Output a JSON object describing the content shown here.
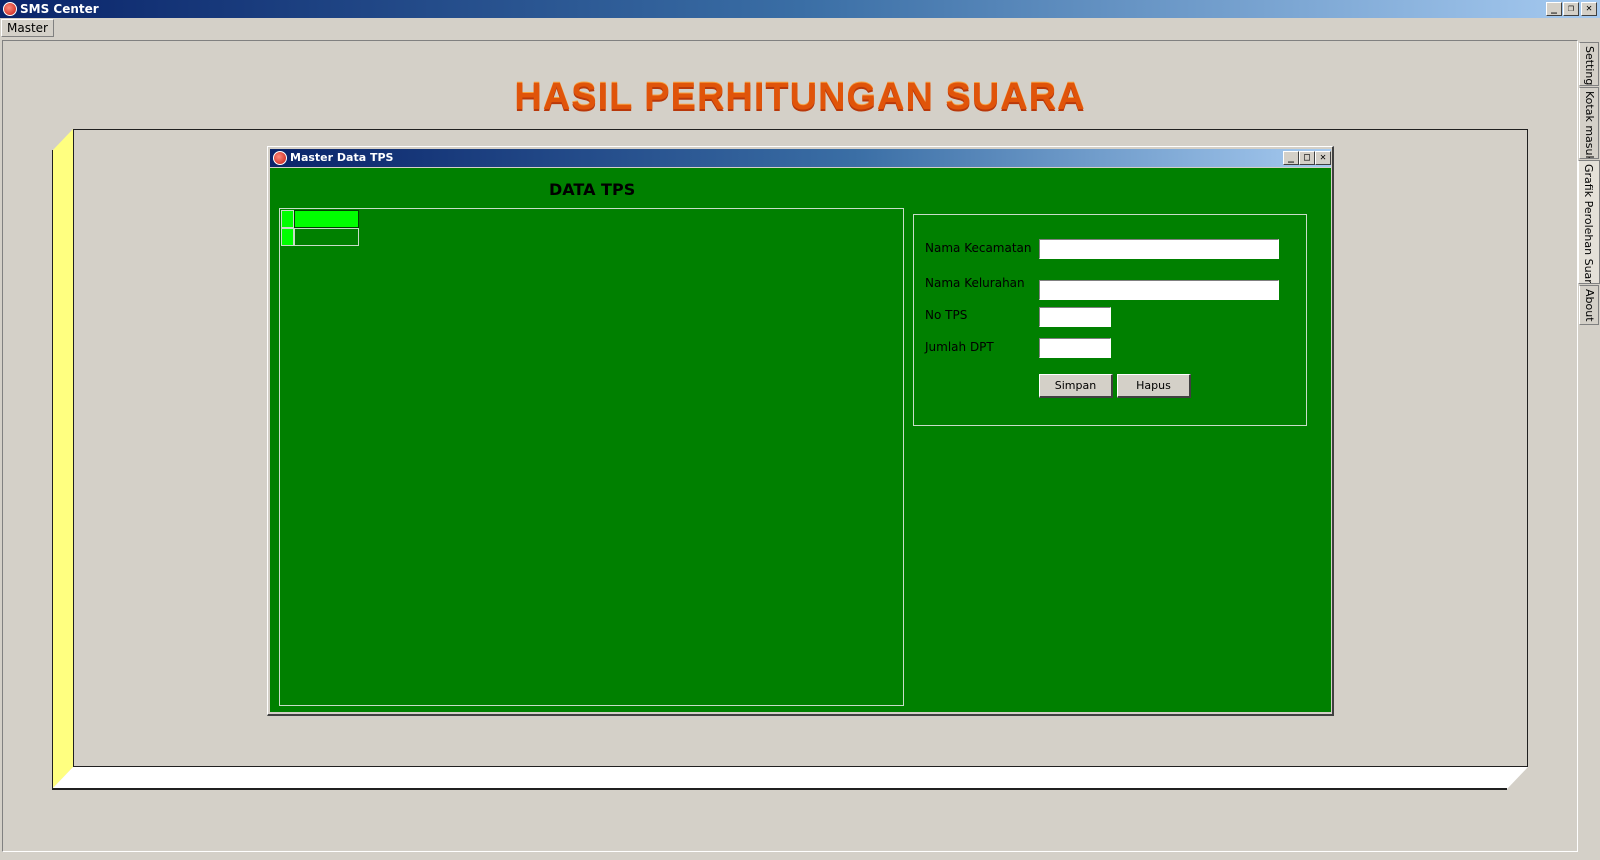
{
  "window": {
    "title": "SMS Center",
    "minimize_glyph": "_",
    "restore_glyph": "❐",
    "close_glyph": "✕"
  },
  "menu": {
    "items": [
      {
        "label": "Master"
      }
    ]
  },
  "banner": {
    "title": "HASIL PERHITUNGAN SUARA",
    "color": "#e0540a"
  },
  "box": {
    "left_color": "#ffff80",
    "bottom_color": "#ffffff"
  },
  "child_window": {
    "title": "Master Data TPS",
    "minimize_glyph": "_",
    "maximize_glyph": "□",
    "close_glyph": "✕",
    "background": "#008000"
  },
  "data_grid": {
    "title": "DATA TPS",
    "rows": [
      {
        "selected": true
      },
      {
        "selected": false
      }
    ],
    "highlight_color": "#00ff00"
  },
  "form": {
    "nama_kecamatan": {
      "label": "Nama Kecamatan",
      "value": ""
    },
    "nama_kelurahan": {
      "label": "Nama Kelurahan",
      "value": ""
    },
    "no_tps": {
      "label": "No TPS",
      "value": ""
    },
    "jumlah_dpt": {
      "label": "Jumlah DPT",
      "value": ""
    },
    "simpan_label": "Simpan",
    "hapus_label": "Hapus"
  },
  "side_tabs": [
    {
      "label": "Setting",
      "active": false
    },
    {
      "label": "Kotak masuk",
      "active": false
    },
    {
      "label": "Grafik Perolehan Suara",
      "active": true
    },
    {
      "label": "About",
      "active": false
    }
  ]
}
